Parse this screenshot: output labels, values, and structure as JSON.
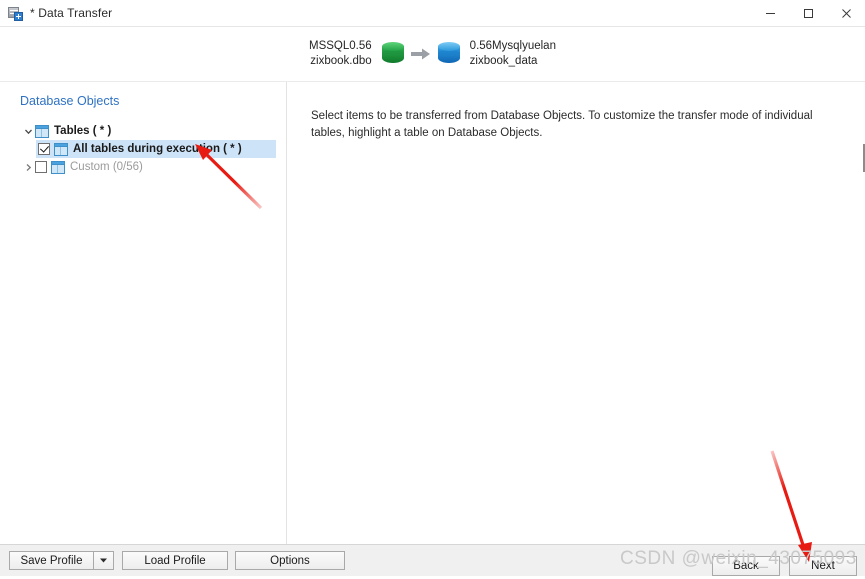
{
  "window": {
    "title": "* Data Transfer",
    "app_icon": "data-transfer-icon",
    "controls": {
      "minimize": "minimize-icon",
      "maximize": "maximize-icon",
      "close": "close-icon"
    }
  },
  "header": {
    "source": {
      "line1": "MSSQL0.56",
      "line2": "zixbook.dbo",
      "icon": "green-database-cylinder-icon",
      "color": "#1d9440"
    },
    "transfer_arrow": "right-arrow-icon",
    "destination": {
      "line1": "0.56Mysqlyuelan",
      "line2": "zixbook_data",
      "icon": "blue-database-cylinder-icon",
      "color": "#1b80cc"
    }
  },
  "left_pane": {
    "title": "Database Objects",
    "title_color": "#2f72c4",
    "tree": [
      {
        "label": "Tables ( * )",
        "level": 0,
        "expanded": true,
        "twisty": "chevron-down-icon",
        "has_checkbox": false,
        "checked": false,
        "muted": false,
        "selected": false,
        "bold": true
      },
      {
        "label": "All tables during execution ( * )",
        "level": 1,
        "expanded": false,
        "twisty": "",
        "has_checkbox": true,
        "checked": true,
        "muted": false,
        "selected": true,
        "bold": true
      },
      {
        "label": "Custom (0/56)",
        "level": 1,
        "expanded": false,
        "twisty": "chevron-right-icon",
        "has_checkbox": true,
        "checked": false,
        "muted": true,
        "selected": false,
        "bold": false
      }
    ],
    "selection_color": "#cde3f7"
  },
  "right_pane": {
    "instructions": "Select items to be transferred from Database Objects. To customize the transfer mode of individual tables, highlight a table on Database Objects."
  },
  "bottom_bar": {
    "save_profile": "Save Profile",
    "save_profile_dropdown": "chevron-down-icon",
    "load_profile": "Load Profile",
    "options": "Options",
    "back": "Back",
    "next": "Next"
  },
  "annotations": {
    "watermark": "CSDN @weixin_43075093",
    "arrow_color": "#e81b12",
    "arrows": [
      {
        "name": "arrow-to-selected-tree-row"
      },
      {
        "name": "arrow-to-next-button"
      }
    ]
  }
}
